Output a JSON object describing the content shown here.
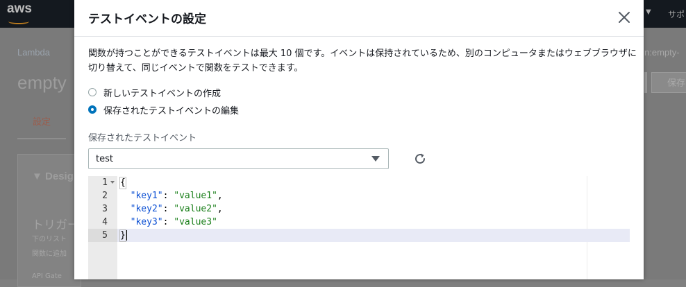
{
  "background": {
    "logo_text": "aws",
    "header_right_text": "サポ",
    "breadcrumb": "Lambda",
    "function_name": "empty",
    "arn_fragment": "n:empty-",
    "save_label": "保存",
    "tab_label": "設定",
    "designer_label": "Desig",
    "trigger_heading": "トリガー",
    "small_text_1": "下のリスト",
    "small_text_2": "関数に追加",
    "small_text_3": "API Gate"
  },
  "modal": {
    "title": "テストイベントの設定",
    "description": "関数が持つことができるテストイベントは最大 10 個です。イベントは保持されているため、別のコンピュータまたはウェブブラウザに切り替えて、同じイベントで関数をテストできます。",
    "radio_options": [
      {
        "label": "新しいテストイベントの作成",
        "checked": false
      },
      {
        "label": "保存されたテストイベントの編集",
        "checked": true
      }
    ],
    "saved_events_label": "保存されたテストイベント",
    "selected_event": "test",
    "editor": {
      "line_numbers": [
        "1",
        "2",
        "3",
        "4",
        "5"
      ],
      "lines": {
        "l1": "{",
        "l2_key": "\"key1\"",
        "l2_val": "\"value1\"",
        "l3_key": "\"key2\"",
        "l3_val": "\"value2\"",
        "l4_key": "\"key3\"",
        "l4_val": "\"value3\"",
        "l5": "}"
      }
    }
  },
  "colors": {
    "accent": "#0073bb",
    "title_text": "#16191f",
    "string": "#1a7f1a",
    "key": "#0b4fd3"
  }
}
